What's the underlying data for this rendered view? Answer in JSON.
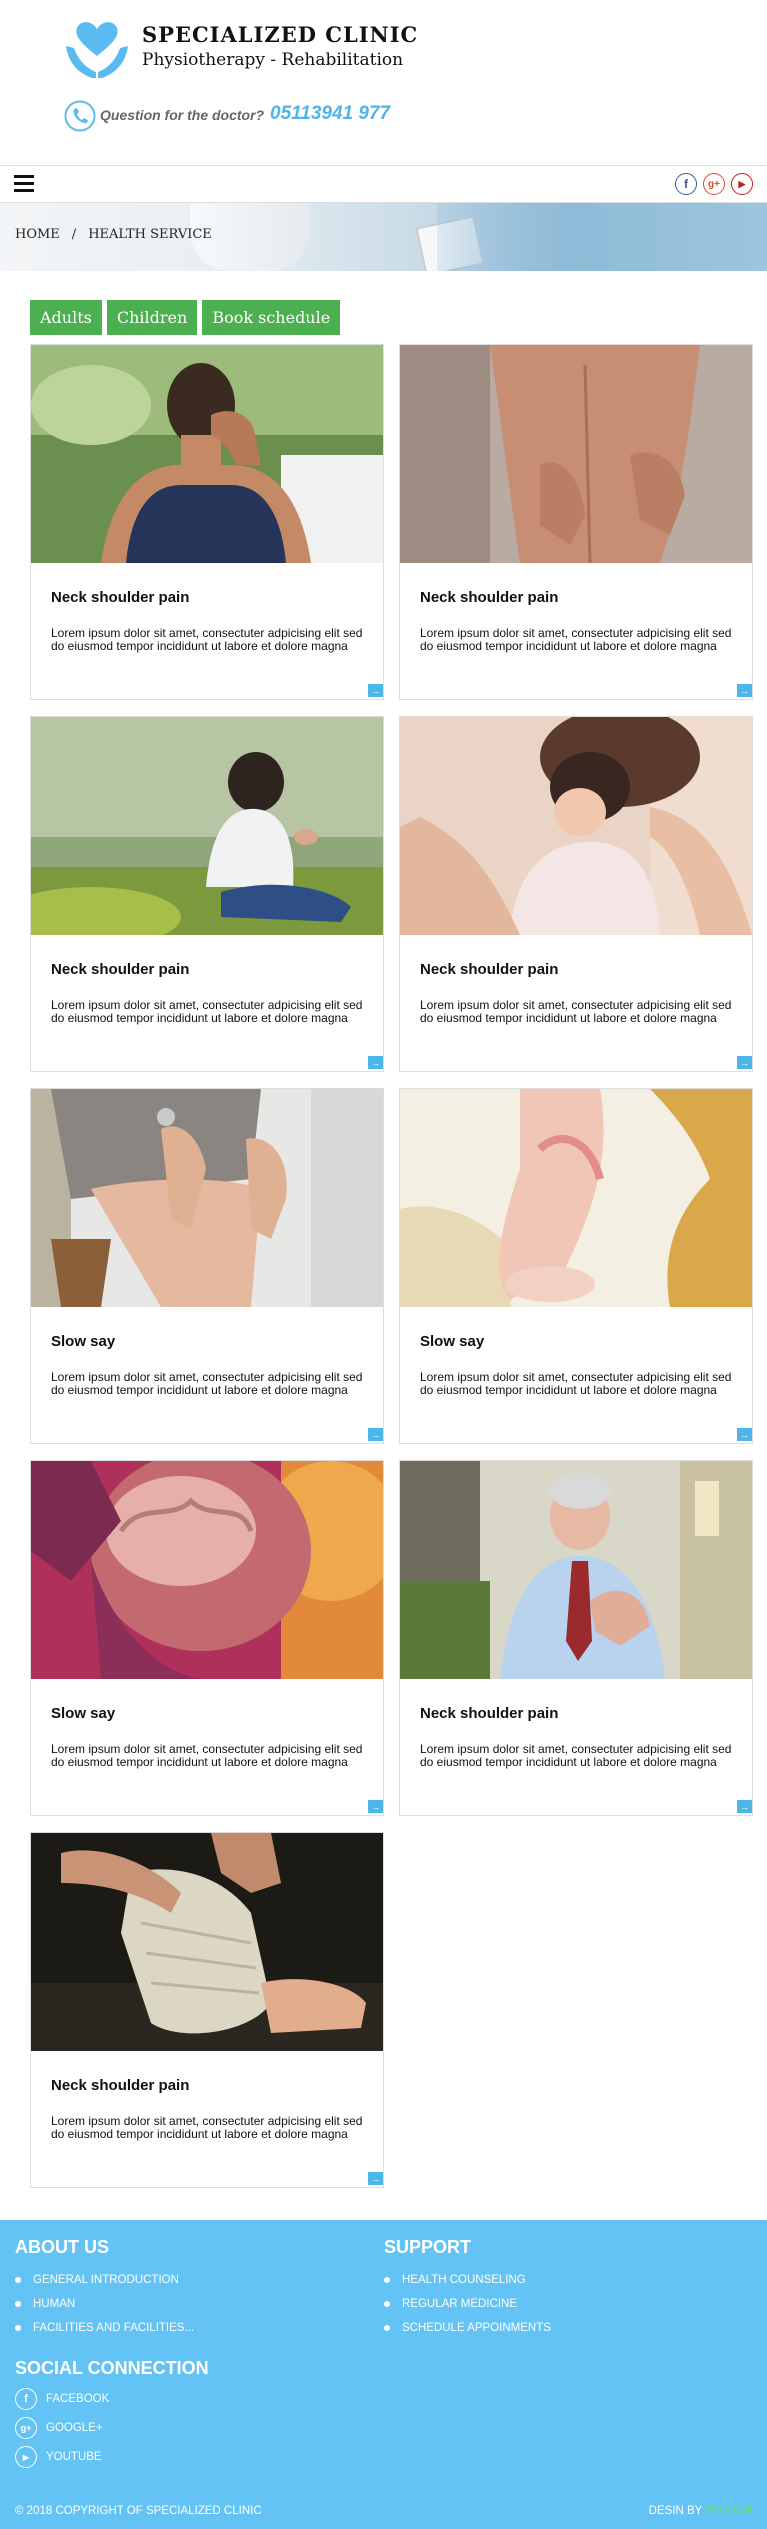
{
  "header": {
    "brand_title": "SPECIALIZED CLINIC",
    "brand_subtitle": "Physiotherapy - Rehabilitation",
    "question": "Question for the doctor?",
    "phone": "05113941 977",
    "logo_icon": "heart-hands-icon",
    "accent_color": "#5bbbf0"
  },
  "nav": {
    "menu_icon": "hamburger-icon",
    "social": [
      {
        "name": "facebook-icon",
        "glyph": "f",
        "color": "#3b5998"
      },
      {
        "name": "google-plus-icon",
        "glyph": "g+",
        "color": "#dd4b39"
      },
      {
        "name": "youtube-icon",
        "glyph": "▶",
        "color": "#cc181e"
      }
    ]
  },
  "breadcrumb": {
    "home": "HOME",
    "separator": "/",
    "current": "HEALTH SERVICE"
  },
  "tabs": [
    "Adults",
    "Children",
    "Book schedule"
  ],
  "tab_color": "#4caf50",
  "cards": [
    {
      "title": "Neck shoulder pain",
      "text": "Lorem ipsum dolor sit amet, consectuter adpicising elit sed do eiusmod tempor incididunt ut labore et dolore magna",
      "image": "woman-neck-pain"
    },
    {
      "title": "Neck shoulder pain",
      "text": "Lorem ipsum dolor sit amet, consectuter adpicising elit sed do eiusmod tempor incididunt ut labore et dolore magna",
      "image": "back-pain"
    },
    {
      "title": "Neck shoulder pain",
      "text": "Lorem ipsum dolor sit amet, consectuter adpicising elit sed do eiusmod tempor incididunt ut labore et dolore magna",
      "image": "boy-sitting-grass"
    },
    {
      "title": "Neck shoulder pain",
      "text": "Lorem ipsum dolor sit amet, consectuter adpicising elit sed do eiusmod tempor incididunt ut labore et dolore magna",
      "image": "mother-hugging-child"
    },
    {
      "title": "Slow say",
      "text": "Lorem ipsum dolor sit amet, consectuter adpicising elit sed do eiusmod tempor incididunt ut labore et dolore magna",
      "image": "knee-pain"
    },
    {
      "title": "Slow say",
      "text": "Lorem ipsum dolor sit amet, consectuter adpicising elit sed do eiusmod tempor incididunt ut labore et dolore magna",
      "image": "foot-high-heel"
    },
    {
      "title": "Slow say",
      "text": "Lorem ipsum dolor sit amet, consectuter adpicising elit sed do eiusmod tempor incididunt ut labore et dolore magna",
      "image": "brain-headache"
    },
    {
      "title": "Neck shoulder pain",
      "text": "Lorem ipsum dolor sit amet, consectuter adpicising elit sed do eiusmod tempor incididunt ut labore et dolore magna",
      "image": "man-chest-pain"
    },
    {
      "title": "Neck shoulder pain",
      "text": "Lorem ipsum dolor sit amet, consectuter adpicising elit sed do eiusmod tempor incididunt ut labore et dolore magna",
      "image": "bandaged-foot"
    }
  ],
  "footer": {
    "about_title": "ABOUT US",
    "about_items": [
      "GENERAL INTRODUCTION",
      "HUMAN",
      "FACILITIES AND FACILITIES..."
    ],
    "support_title": "SUPPORT",
    "support_items": [
      "HEALTH COUNSELING",
      "REGULAR MEDICINE",
      "SCHEDULE APPOINMENTS"
    ],
    "social_title": "SOCIAL CONNECTION",
    "social_links": [
      {
        "label": "FACEBOOK",
        "icon": "facebook-icon",
        "glyph": "f"
      },
      {
        "label": "GOOGLE+",
        "icon": "google-plus-icon",
        "glyph": "g+"
      },
      {
        "label": "YOUTUBE",
        "icon": "youtube-icon",
        "glyph": "▶"
      }
    ],
    "copyright": "© 2018 COPYRIGHT OF SPECIALIZED CLINIC",
    "design_prefix": "DESIN BY",
    "design_brand": "DD.COM",
    "bg_color": "#63c3f5"
  }
}
